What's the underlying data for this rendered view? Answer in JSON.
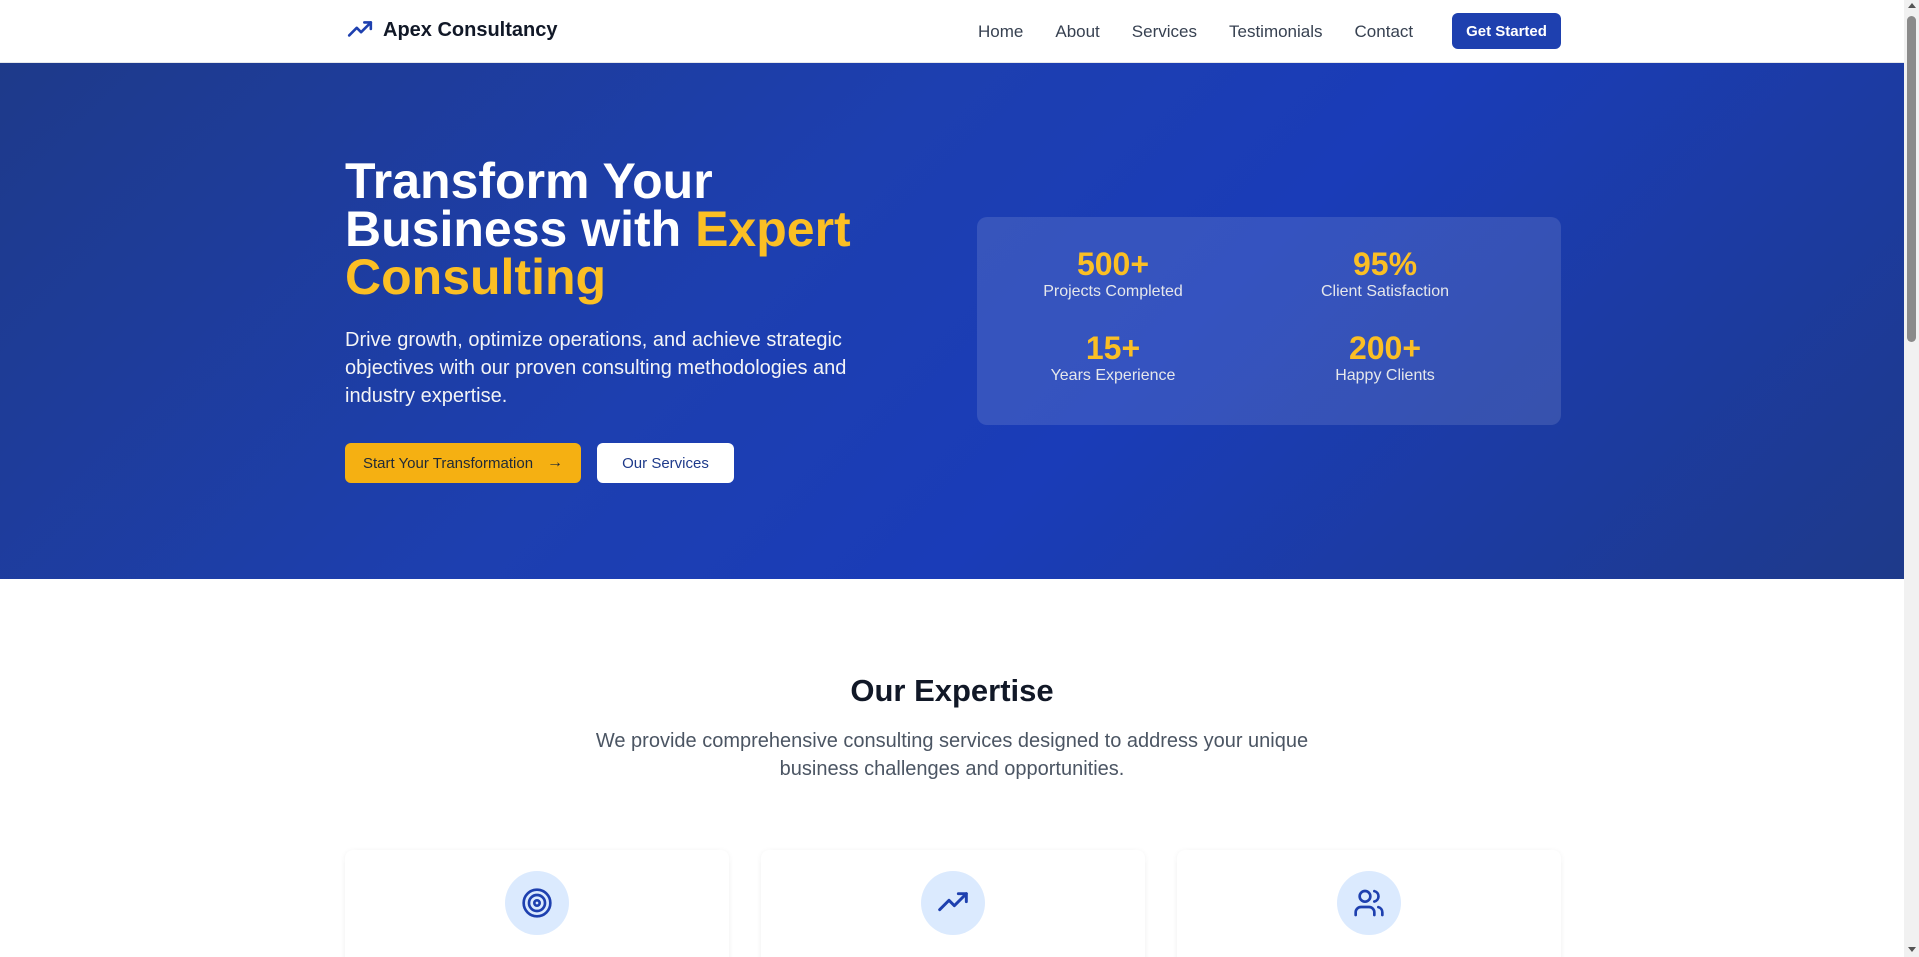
{
  "nav": {
    "brand": "Apex Consultancy",
    "links": [
      "Home",
      "About",
      "Services",
      "Testimonials",
      "Contact"
    ],
    "cta": "Get Started"
  },
  "hero": {
    "title_part1": "Transform Your Business with ",
    "title_accent": "Expert Consulting",
    "subtitle": "Drive growth, optimize operations, and achieve strategic objectives with our proven consulting methodologies and industry expertise.",
    "primary_button": "Start Your Transformation",
    "secondary_button": "Our Services",
    "stats": [
      {
        "value": "500+",
        "label": "Projects Completed"
      },
      {
        "value": "95%",
        "label": "Client Satisfaction"
      },
      {
        "value": "15+",
        "label": "Years Experience"
      },
      {
        "value": "200+",
        "label": "Happy Clients"
      }
    ]
  },
  "expertise": {
    "title": "Our Expertise",
    "subtitle": "We provide comprehensive consulting services designed to address your unique business challenges and opportunities.",
    "cards": [
      {
        "icon": "target-icon"
      },
      {
        "icon": "trending-up-icon"
      },
      {
        "icon": "users-icon"
      }
    ]
  },
  "colors": {
    "brand_blue": "#1e40af",
    "accent_yellow": "#fbbf24",
    "hero_bg": "#1d3fb0"
  }
}
